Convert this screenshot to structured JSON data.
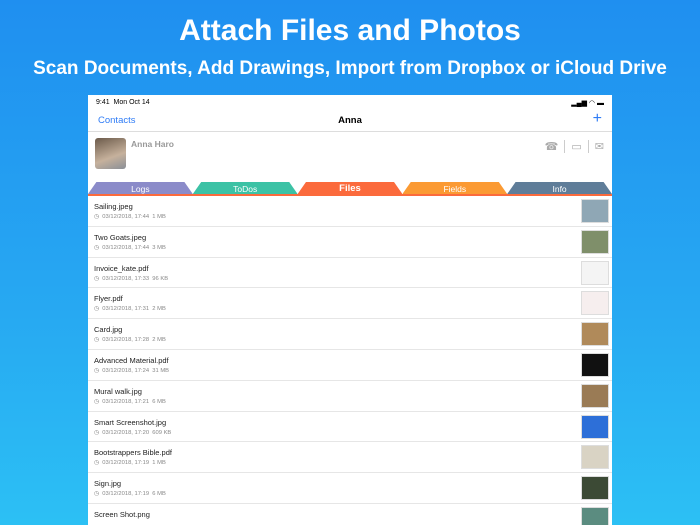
{
  "headline": "Attach Files and Photos",
  "subheadline": "Scan Documents, Add Drawings, Import from Dropbox or iCloud Drive",
  "status": {
    "time": "9:41",
    "date": "Mon Oct 14"
  },
  "nav": {
    "back": "Contacts",
    "title": "Anna",
    "add": "+"
  },
  "contact": {
    "name": "Anna Haro"
  },
  "tabs": [
    {
      "label": "Logs",
      "color": "#8b8bc9"
    },
    {
      "label": "ToDos",
      "color": "#3cc2a5"
    },
    {
      "label": "Files",
      "color": "#fb6a3c"
    },
    {
      "label": "Fields",
      "color": "#fb9a33"
    },
    {
      "label": "Info",
      "color": "#5f7d99"
    }
  ],
  "files": [
    {
      "name": "Sailing.jpeg",
      "date": "03/12/2018, 17:44",
      "size": "1 MB",
      "thumb": "#8fa7b5"
    },
    {
      "name": "Two Goats.jpeg",
      "date": "03/12/2018, 17:44",
      "size": "3 MB",
      "thumb": "#7f8f6a"
    },
    {
      "name": "Invoice_kate.pdf",
      "date": "03/12/2018, 17:33",
      "size": "96 KB",
      "thumb": "#f4f4f4"
    },
    {
      "name": "Flyer.pdf",
      "date": "03/12/2018, 17:31",
      "size": "2 MB",
      "thumb": "#f6eeee"
    },
    {
      "name": "Card.jpg",
      "date": "03/12/2018, 17:28",
      "size": "2 MB",
      "thumb": "#b08a5a"
    },
    {
      "name": "Advanced Material.pdf",
      "date": "03/12/2018, 17:24",
      "size": "31 MB",
      "thumb": "#111111"
    },
    {
      "name": "Mural walk.jpg",
      "date": "03/12/2018, 17:21",
      "size": "6 MB",
      "thumb": "#9a7b55"
    },
    {
      "name": "Smart Screenshot.jpg",
      "date": "03/12/2018, 17:20",
      "size": "609 KB",
      "thumb": "#2d6fd8"
    },
    {
      "name": "Bootstrappers Bible.pdf",
      "date": "03/12/2018, 17:19",
      "size": "1 MB",
      "thumb": "#d9d3c4"
    },
    {
      "name": "Sign.jpg",
      "date": "03/12/2018, 17:19",
      "size": "6 MB",
      "thumb": "#3c4a35"
    },
    {
      "name": "Screen Shot.png",
      "date": "",
      "size": "",
      "thumb": "#5b8c80"
    }
  ]
}
